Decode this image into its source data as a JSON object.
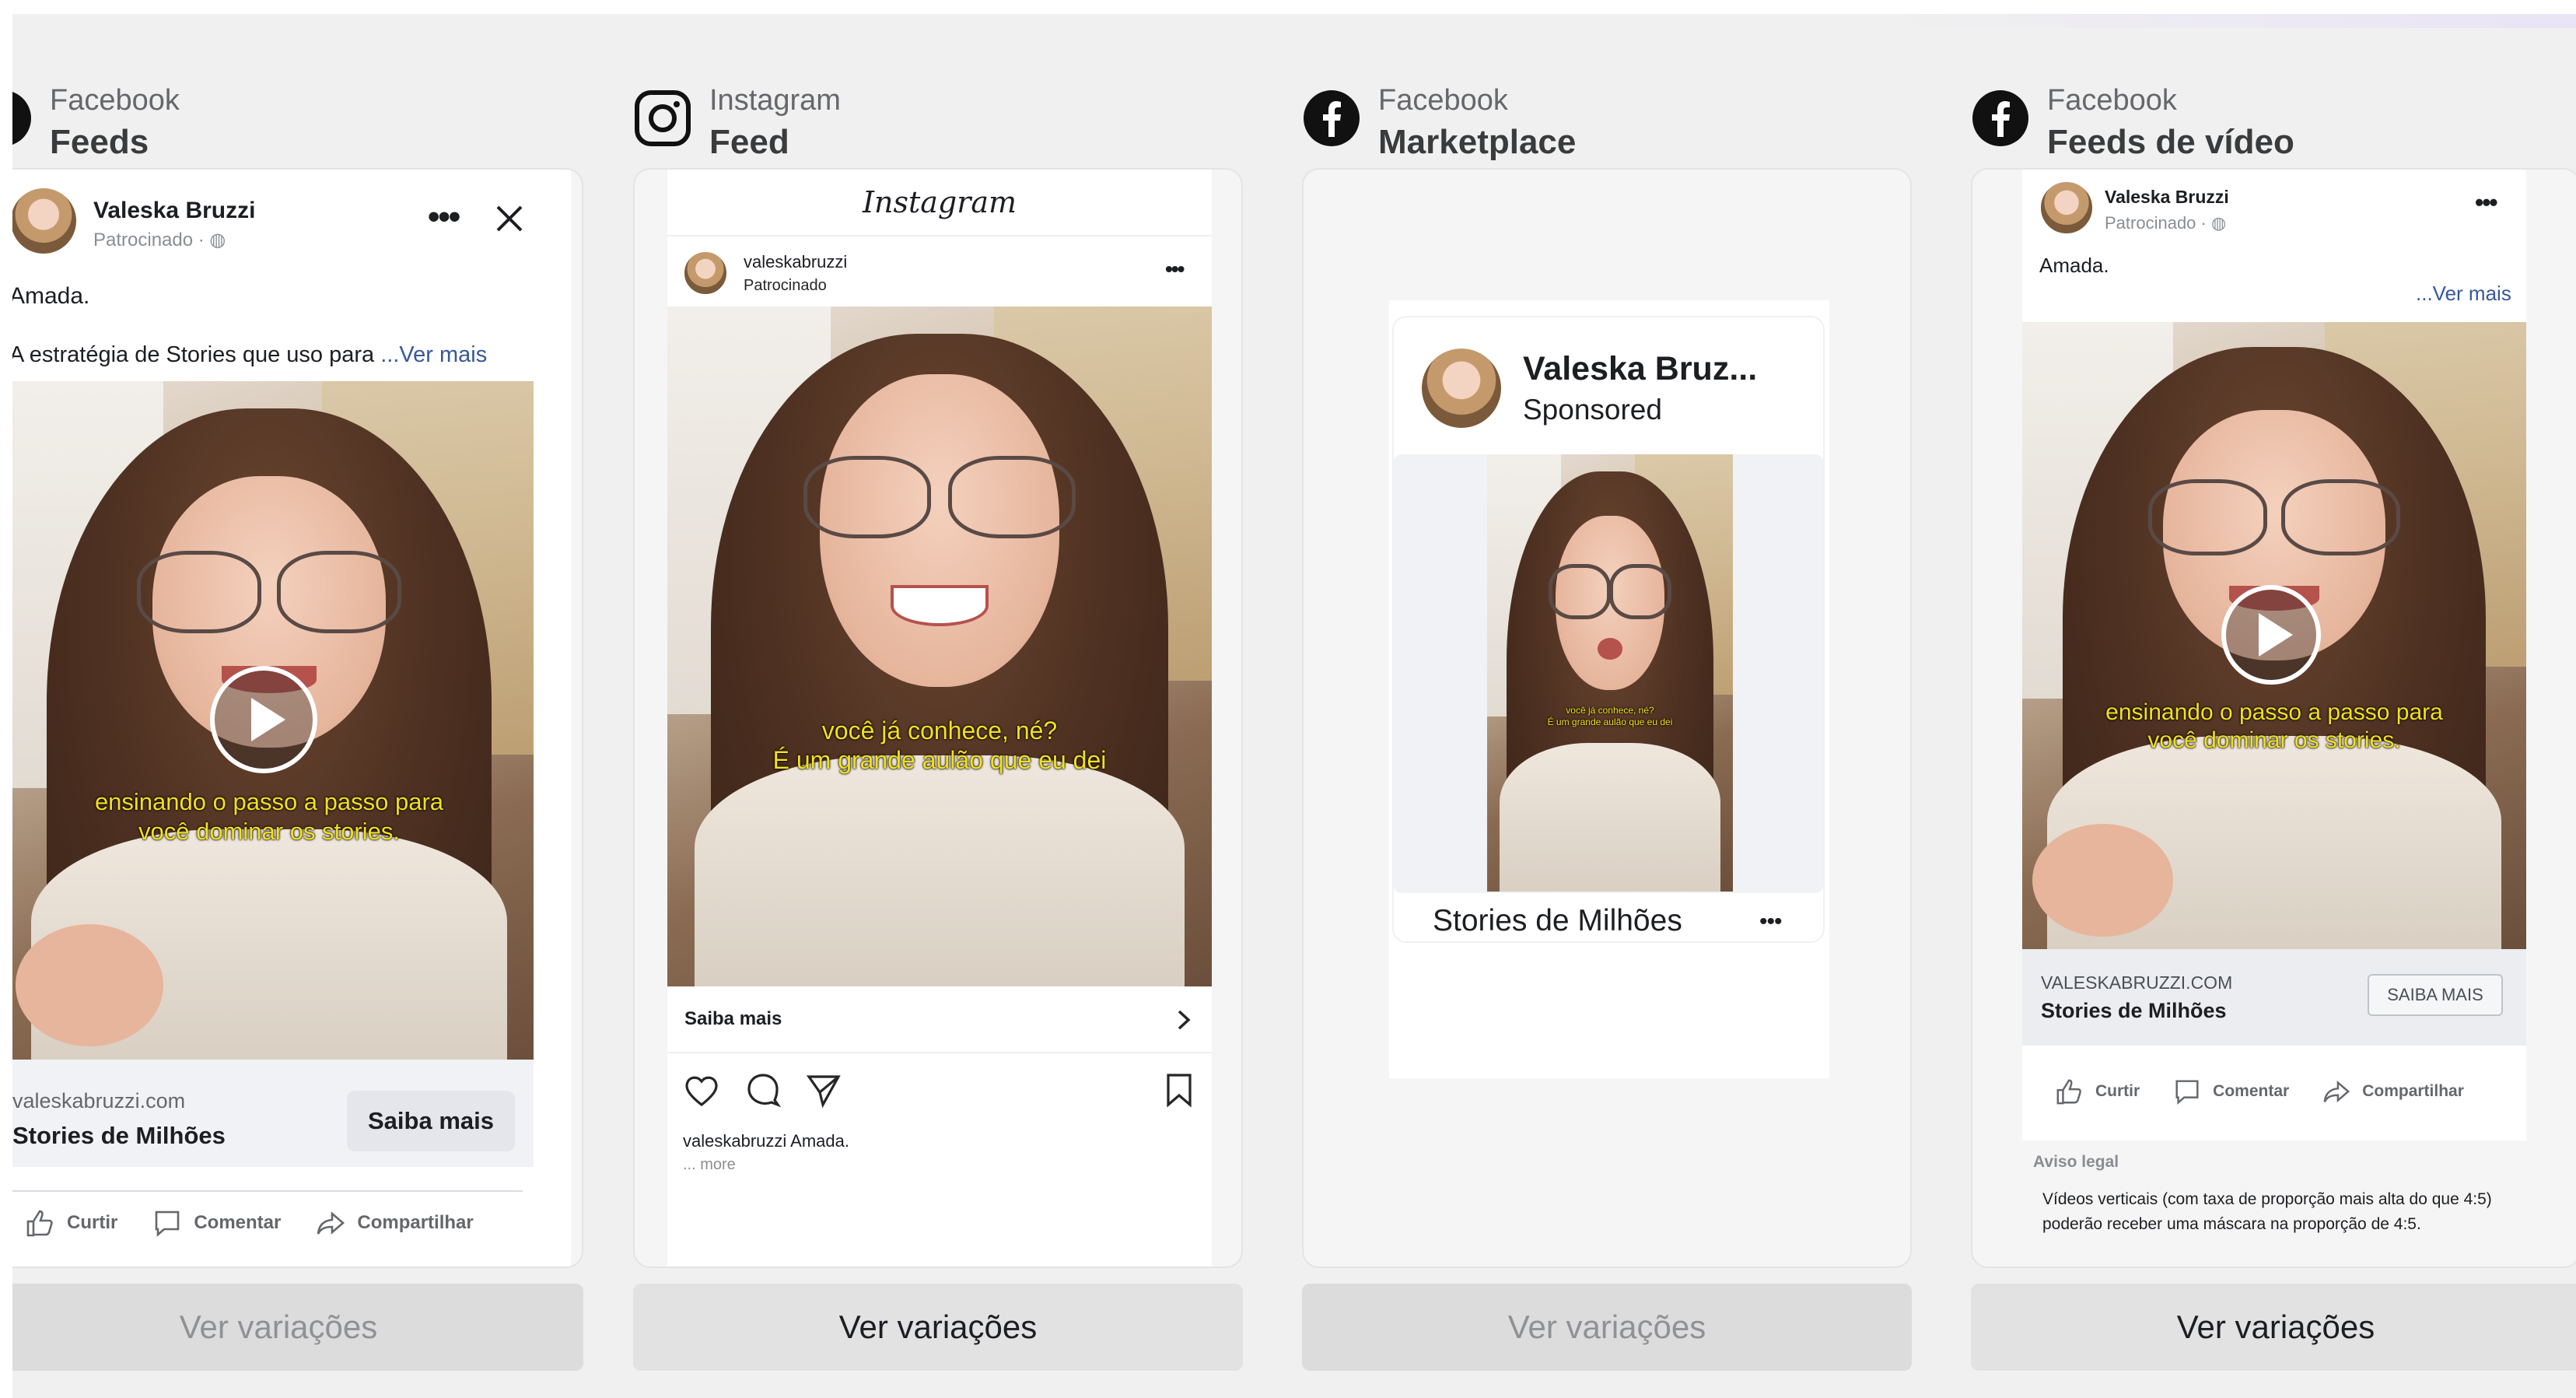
{
  "columns": [
    {
      "platform": "Facebook",
      "placement": "Feeds",
      "button": "Ver variações"
    },
    {
      "platform": "Instagram",
      "placement": "Feed",
      "button": "Ver variações"
    },
    {
      "platform": "Facebook",
      "placement": "Marketplace",
      "button": "Ver variações"
    },
    {
      "platform": "Facebook",
      "placement": "Feeds de vídeo",
      "button": "Ver variações"
    }
  ],
  "fb_feed": {
    "name": "Valeska Bruzzi",
    "sponsored": "Patrocinado · ",
    "line1": "Amada.",
    "line2": "A estratégia de Stories que uso para",
    "see_more": "...Ver mais",
    "caption1": "ensinando o passo a passo para",
    "caption2": "você dominar os stories.",
    "domain": "valeskabruzzi.com",
    "headline": "Stories de Milhões",
    "cta": "Saiba mais",
    "like": "Curtir",
    "comment": "Comentar",
    "share": "Compartilhar"
  },
  "ig_feed": {
    "logo": "Instagram",
    "username": "valeskabruzzi",
    "sponsored": "Patrocinado",
    "caption1": "você já conhece, né?",
    "caption2": "É um grande aulão que eu dei",
    "cta": "Saiba mais",
    "caption_user": "valeskabruzzi",
    "caption_text": " Amada.",
    "more": "... more"
  },
  "marketplace": {
    "name": "Valeska Bruz...",
    "sponsored": "Sponsored",
    "mini_caption1": "você já conhece, né?",
    "mini_caption2": "É um grande aulão que eu dei",
    "headline": "Stories de Milhões",
    "dots": "•••"
  },
  "fb_video": {
    "name": "Valeska Bruzzi",
    "sponsored": "Patrocinado · ",
    "line1": "Amada.",
    "see_more": "...Ver mais",
    "caption1": "ensinando o passo a passo para",
    "caption2": "você dominar os stories.",
    "domain": "VALESKABRUZZI.COM",
    "headline": "Stories de Milhões",
    "cta": "SAIBA MAIS",
    "like": "Curtir",
    "comment": "Comentar",
    "share": "Compartilhar",
    "legal_title": "Aviso legal",
    "legal_text": "Vídeos verticais (com taxa de proporção mais alta do que 4:5) poderão receber uma máscara na proporção de 4:5."
  },
  "colors": {
    "link": "#385898",
    "caption": "#f2e11a",
    "bg": "#f0f0f0"
  }
}
